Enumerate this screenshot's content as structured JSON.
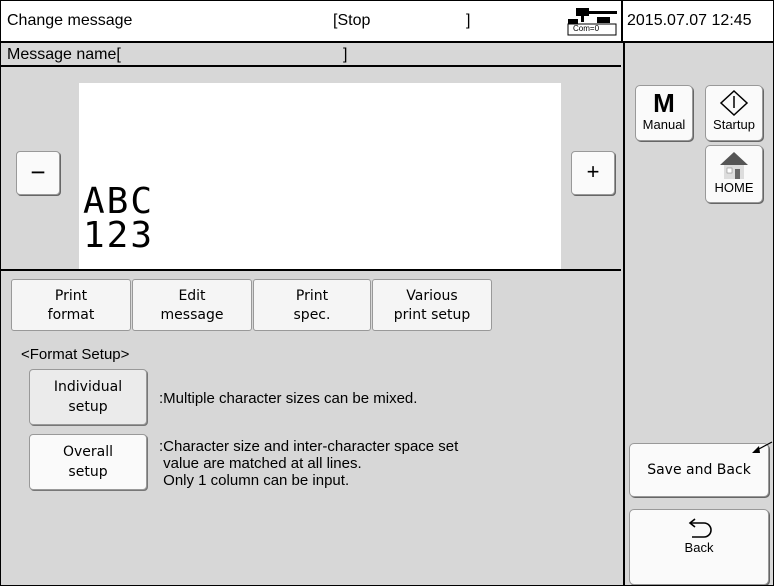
{
  "header": {
    "title": "Change message",
    "status_open": "[Stop",
    "status_close": "]",
    "com_label": "Com=0",
    "datetime": "2015.07.07 12:45"
  },
  "message_name": {
    "label": "Message name[",
    "close": "]"
  },
  "preview": {
    "minus_label": "−",
    "plus_label": "+",
    "line1": "ABC",
    "line2": "123"
  },
  "tabs": [
    {
      "line1": "Print",
      "line2": "format"
    },
    {
      "line1": "Edit",
      "line2": "message"
    },
    {
      "line1": "Print",
      "line2": "spec."
    },
    {
      "line1": "Various",
      "line2": "print setup"
    }
  ],
  "format_setup": {
    "heading": "<Format Setup>",
    "individual": {
      "line1": "Individual",
      "line2": "setup",
      "desc": ":Multiple character sizes can be mixed."
    },
    "overall": {
      "line1": "Overall",
      "line2": "setup",
      "desc_lines": [
        ":Character size and inter-character space set",
        " value are matched at all lines.",
        " Only 1 column can be input."
      ]
    }
  },
  "sidebar": {
    "manual_letter": "M",
    "manual_label": "Manual",
    "startup_label": "Startup",
    "home_label": "HOME",
    "save_back_label": "Save and Back",
    "back_label": "Back"
  },
  "icons": [
    "com-status-icon",
    "startup-diamond-icon",
    "home-icon",
    "back-arrow-icon"
  ],
  "colors": {
    "panel_gray": "#d7d7d7",
    "button_face": "#fafafa",
    "selected_button": "#ebebeb"
  }
}
